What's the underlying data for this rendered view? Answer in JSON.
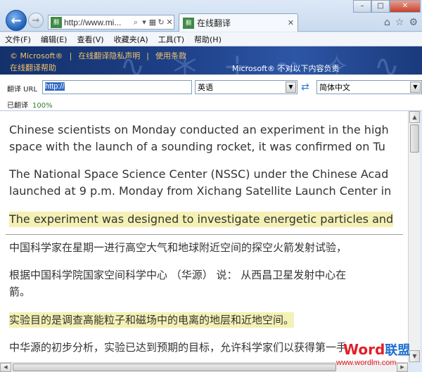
{
  "browser": {
    "address_url": "http://www.mi...",
    "tab_title": "在线翻译",
    "site_icon_text": "翻",
    "window_controls": {
      "minimize": "–",
      "maximize": "□",
      "close": "✕"
    }
  },
  "menu": {
    "items": [
      "文件(F)",
      "编辑(E)",
      "查看(V)",
      "收藏夹(A)",
      "工具(T)",
      "帮助(H)"
    ]
  },
  "banner": {
    "brand": "© Microsoft®",
    "privacy_link": "在线翻译隐私声明",
    "terms_link": "使用条款",
    "help_link": "在线翻译帮助",
    "disclaimer": "Microsoft® 不对以下内容负责",
    "separator": "|"
  },
  "translator": {
    "url_label": "翻译 URL",
    "url_value": "http://",
    "from_language": "英语",
    "to_language": "简体中文",
    "translated_label": "已翻译",
    "translated_percent": "100%"
  },
  "content": {
    "en_p1_line1": "Chinese scientists on Monday conducted an experiment in the high",
    "en_p1_line2": "space with the launch of a sounding rocket, it was confirmed on Tu",
    "en_p2_line1": "The National Space Science Center (NSSC) under the Chinese Acad",
    "en_p2_line2": "launched at 9 p.m. Monday from Xichang Satellite Launch Center in",
    "en_p3_line1": "The experiment was designed to investigate energetic particles and",
    "zh_p1_line1": "中国科学家在星期一进行高空大气和地球附近空间的探空火箭发射试验，",
    "zh_p2_line1": "根据中国科学院国家空间科学中心 （华源） 说： 从西昌卫星发射中心在",
    "zh_p2_line2": "箭。",
    "zh_p3_line1": "实验目的是调查高能粒子和磁场中的电离的地层和近地空间。",
    "zh_p4_line1": "中华源的初步分析，实验已达到预期的目标，允许科学家们以获得第一手"
  },
  "watermark": {
    "logo_word": "Word",
    "logo_zh": "联盟",
    "site": "www.wordlm.com"
  },
  "colors": {
    "banner_link": "#f1c26b",
    "highlight": "#f5f1b5",
    "percent_green": "#2e7d32"
  }
}
